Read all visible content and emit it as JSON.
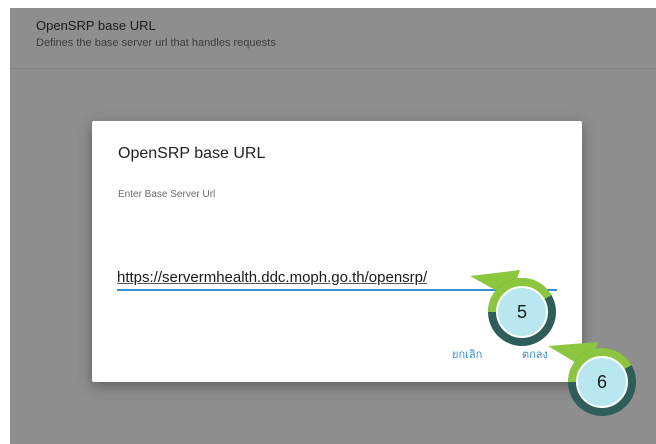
{
  "preference": {
    "title": "OpenSRP base URL",
    "summary": "Defines the base server url that handles requests"
  },
  "dialog": {
    "title": "OpenSRP base URL",
    "message": "Enter Base Server Url",
    "url_value": "https://servermhealth.ddc.moph.go.th/opensrp/",
    "cancel_label": "ยกเลิก",
    "ok_label": "ตกลง"
  },
  "markers": [
    {
      "number": "5"
    },
    {
      "number": "6"
    }
  ],
  "colors": {
    "accent": "#3a8fcf",
    "marker_green": "#8cc63f",
    "marker_dark": "#2f5d5a",
    "marker_fill": "#b9e7ef"
  }
}
